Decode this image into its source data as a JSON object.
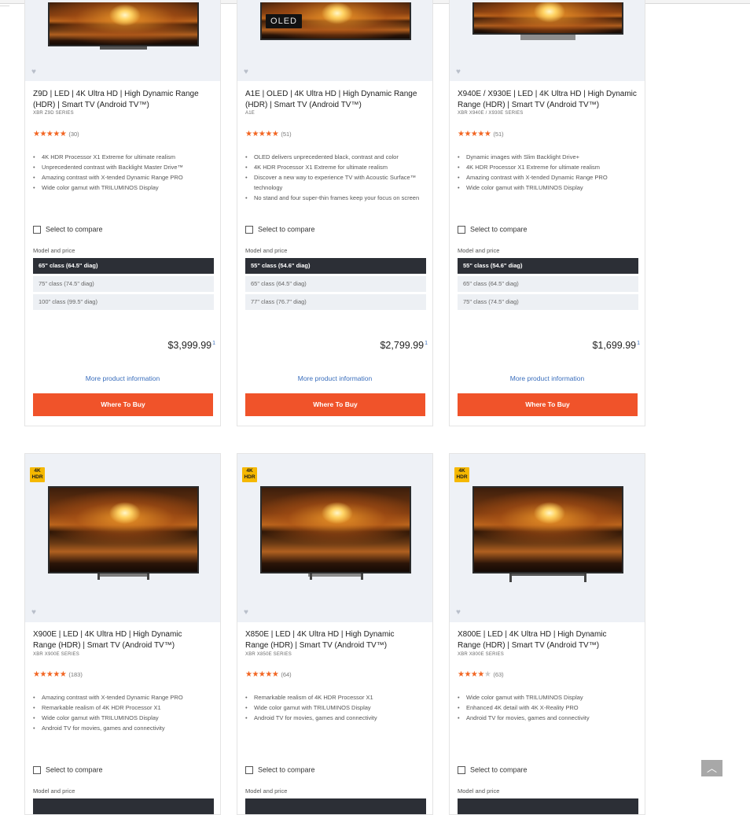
{
  "products": [
    {
      "title": "Z9D | LED | 4K Ultra HD | High Dynamic Range (HDR) | Smart TV (Android TV™)",
      "series": "XBR Z9D SERIES",
      "rating_count": "(30)",
      "rating_stars": 4.5,
      "features": [
        "4K HDR Processor X1 Extreme for ultimate realism",
        "Unprecedented contrast with Backlight Master Drive™",
        "Amazing contrast with X-tended Dynamic Range PRO",
        "Wide color gamut with TRILUMINOS Display"
      ],
      "compare_label": "Select to compare",
      "model_label": "Model and price",
      "sizes": [
        "65\" class (64.5\" diag)",
        "75\" class (74.5\" diag)",
        "100\" class (99.5\" diag)"
      ],
      "price": "$3,999.99",
      "price_note": "1",
      "more_info": "More product information",
      "buy": "Where To Buy"
    },
    {
      "badge": "OLED",
      "title": "A1E | OLED | 4K Ultra HD | High Dynamic Range (HDR) | Smart TV (Android TV™)",
      "series": "A1E",
      "rating_count": "(51)",
      "rating_stars": 4.5,
      "features": [
        "OLED delivers unprecedented black, contrast and color",
        "4K HDR Processor X1 Extreme for ultimate realism",
        "Discover a new way to experience TV with Acoustic Surface™ technology",
        "No stand and four super-thin frames keep your focus on screen"
      ],
      "compare_label": "Select to compare",
      "model_label": "Model and price",
      "sizes": [
        "55\" class (54.6\" diag)",
        "65\" class (64.5\" diag)",
        "77\" class (76.7\" diag)"
      ],
      "price": "$2,799.99",
      "price_note": "1",
      "more_info": "More product information",
      "buy": "Where To Buy"
    },
    {
      "title": "X940E / X930E | LED | 4K Ultra HD | High Dynamic Range (HDR) | Smart TV (Android TV™)",
      "series": "XBR X940E / X930E SERIES",
      "rating_count": "(51)",
      "rating_stars": 4.5,
      "features": [
        "Dynamic images with Slim Backlight Drive+",
        "4K HDR Processor X1 Extreme for ultimate realism",
        "Amazing contrast with X-tended Dynamic Range PRO",
        "Wide color gamut with TRILUMINOS Display"
      ],
      "compare_label": "Select to compare",
      "model_label": "Model and price",
      "sizes": [
        "55\" class (54.6\" diag)",
        "65\" class (64.5\" diag)",
        "75\" class (74.5\" diag)"
      ],
      "price": "$1,699.99",
      "price_note": "1",
      "more_info": "More product information",
      "buy": "Where To Buy"
    },
    {
      "badge": "4K HDR",
      "title": "X900E | LED | 4K Ultra HD | High Dynamic Range (HDR) | Smart TV (Android TV™)",
      "series": "XBR X900E SERIES",
      "rating_count": "(183)",
      "rating_stars": 4.5,
      "features": [
        "Amazing contrast with X-tended Dynamic Range PRO",
        "Remarkable realism of 4K HDR Processor X1",
        "Wide color gamut with TRILUMINOS Display",
        "Android TV for movies, games and connectivity"
      ],
      "compare_label": "Select to compare",
      "model_label": "Model and price"
    },
    {
      "badge": "4K HDR",
      "title": "X850E | LED | 4K Ultra HD | High Dynamic Range (HDR) | Smart TV (Android TV™)",
      "series": "XBR X850E SERIES",
      "rating_count": "(64)",
      "rating_stars": 4.5,
      "features": [
        "Remarkable realism of 4K HDR Processor X1",
        "Wide color gamut with TRILUMINOS Display",
        "Android TV for movies, games and connectivity"
      ],
      "compare_label": "Select to compare",
      "model_label": "Model and price"
    },
    {
      "badge": "4K HDR",
      "title": "X800E | LED | 4K Ultra HD | High Dynamic Range (HDR) | Smart TV (Android TV™)",
      "series": "XBR X800E SERIES",
      "rating_count": "(63)",
      "rating_stars": 4,
      "features": [
        "Wide color gamut with TRILUMINOS Display",
        "Enhanced 4K detail with 4K X-Reality PRO",
        "Android TV for movies, games and connectivity"
      ],
      "compare_label": "Select to compare",
      "model_label": "Model and price"
    }
  ],
  "badge_4k": {
    "line1": "4K",
    "line2": "HDR"
  },
  "icons": {
    "heart": "heart-icon",
    "star": "star-icon",
    "back_to_top": "chevron-up-icon"
  },
  "colors": {
    "accent": "#f0532a",
    "selected_size": "#2c2f36",
    "link": "#3a6ebc",
    "badge_4k": "#f5b800"
  }
}
